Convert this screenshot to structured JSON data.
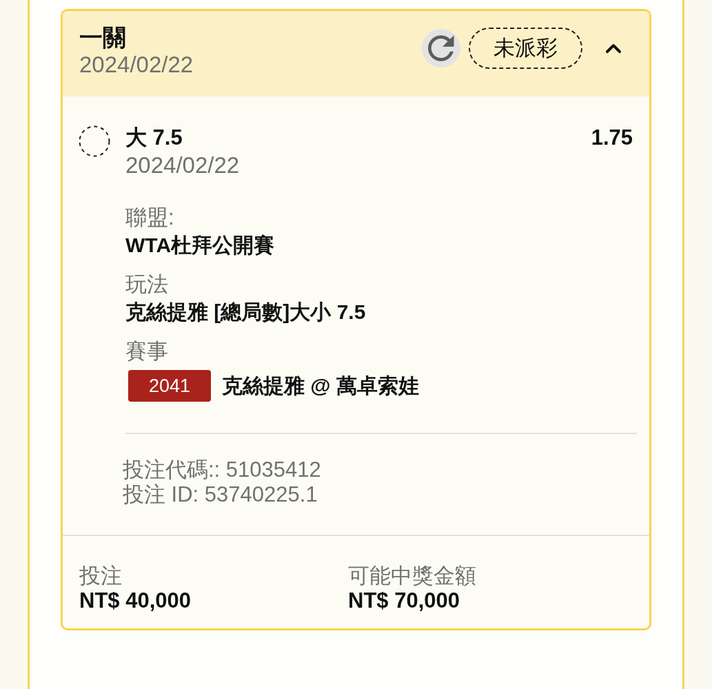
{
  "bet_card": {
    "title": "一關",
    "date": "2024/02/22",
    "status": "未派彩",
    "expanded": true,
    "selection": {
      "pick": "大 7.5",
      "odds": "1.75",
      "date": "2024/02/22",
      "details": [
        {
          "kind": "text",
          "label": "聯盟:",
          "value": "WTA杜拜公開賽"
        },
        {
          "kind": "text",
          "label": "玩法",
          "value": "克絲提雅 [總局數]大小 7.5"
        },
        {
          "kind": "event",
          "label": "賽事",
          "event_code": "2041",
          "value": "克絲提雅 @ 萬卓索娃"
        }
      ]
    },
    "codes": [
      "投注代碼:: 51035412",
      "投注 ID: 53740225.1"
    ],
    "totals": [
      {
        "label": "投注",
        "value": "NT$ 40,000"
      },
      {
        "label": "可能中獎金額",
        "value": "NT$ 70,000"
      }
    ]
  }
}
